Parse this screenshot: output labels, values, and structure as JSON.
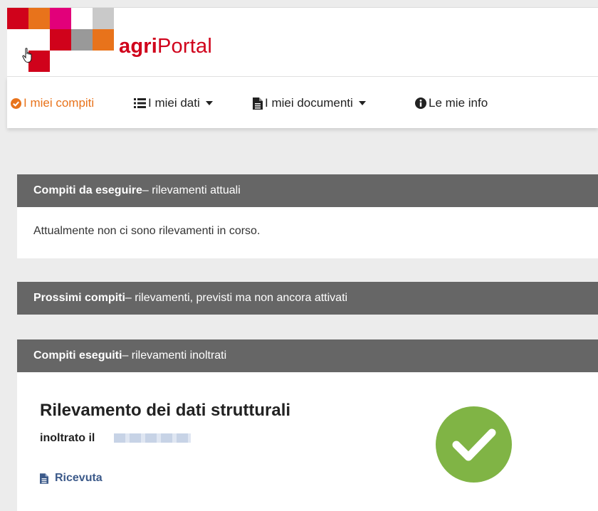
{
  "brand": {
    "part1": "agri",
    "part2": "Portal"
  },
  "nav": {
    "items": [
      {
        "label": "I miei compiti",
        "icon": "check-circle-icon",
        "active": true
      },
      {
        "label": "I miei dati",
        "icon": "list-icon",
        "dropdown": true
      },
      {
        "label": "I miei documenti",
        "icon": "file-icon",
        "dropdown": true
      },
      {
        "label": "Le mie info",
        "icon": "info-circle-icon"
      }
    ]
  },
  "sections": {
    "current": {
      "title_bold": "Compiti da eseguire",
      "title_rest": " – rilevamenti attuali",
      "message": "Attualmente non ci sono rilevamenti in corso."
    },
    "upcoming": {
      "title_bold": "Prossimi compiti",
      "title_rest": " – rilevamenti, previsti ma non ancora attivati"
    },
    "done": {
      "title_bold": "Compiti eseguiti",
      "title_rest": " – rilevamenti inoltrati",
      "task": {
        "title": "Rilevamento dei dati strutturali",
        "submitted_label": "inoltrato il",
        "receipt_label": "Ricevuta"
      }
    }
  },
  "colors": {
    "accent": "#e8731b",
    "brand_red": "#d0021b",
    "header_bar": "#666666",
    "success": "#80b445",
    "link": "#3c5a8a"
  }
}
